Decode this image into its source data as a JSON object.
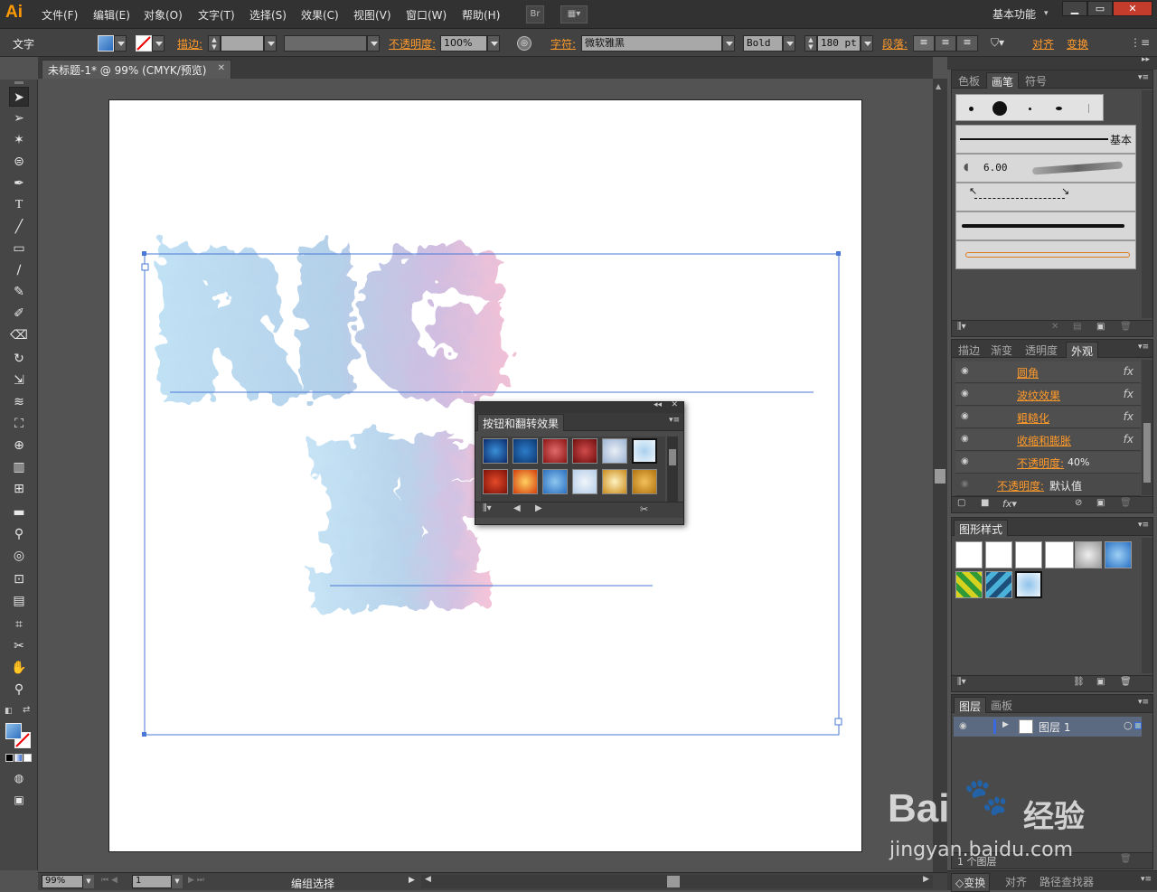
{
  "app": {
    "logo": "Ai",
    "workspace": "基本功能",
    "win_min": "▁",
    "win_max": "▭",
    "win_close": "✕"
  },
  "menus": [
    "文件(F)",
    "编辑(E)",
    "对象(O)",
    "文字(T)",
    "选择(S)",
    "效果(C)",
    "视图(V)",
    "窗口(W)",
    "帮助(H)"
  ],
  "menu_buttons": {
    "bridge": "Br"
  },
  "control": {
    "type_label": "文字",
    "stroke_label": "描边:",
    "opacity_label": "不透明度:",
    "opacity_value": "100%",
    "char_label": "字符:",
    "font": "微软雅黑",
    "weight": "Bold",
    "size": "180 pt",
    "para_label": "段落:",
    "align_label": "对齐",
    "transform_label": "变换"
  },
  "document": {
    "tab": "未标题-1* @ 99% (CMYK/预览)",
    "close": "✕",
    "artwork_text": "RIG",
    "artwork_text_2": "蓝"
  },
  "status": {
    "zoom": "99%",
    "page": "1",
    "mode": "编组选择"
  },
  "brushes_panel": {
    "tabs": [
      "色板",
      "画笔",
      "符号"
    ],
    "basic": "基本",
    "size": "6.00"
  },
  "appearance_panel": {
    "tabs": [
      "描边",
      "渐变",
      "透明度",
      "外观"
    ],
    "rows": [
      "圆角",
      "波纹效果",
      "粗糙化",
      "收缩和膨胀"
    ],
    "opacity_row": "不透明度:",
    "opacity_row_value": "40%",
    "opacity_default": "不透明度:",
    "opacity_default_value": "默认值",
    "fx": "fx"
  },
  "graphic_styles": {
    "title": "图形样式"
  },
  "layers_panel": {
    "tabs": [
      "图层",
      "画板"
    ],
    "layer_name": "图层 1",
    "count": "1 个图层"
  },
  "bottom_tabs": [
    "◇变换",
    "对齐",
    "路径查找器"
  ],
  "float_panel": {
    "title": "按钮和翻转效果"
  },
  "watermark": {
    "brand": "Bai",
    "brand2": "经验",
    "url": "jingyan.baidu.com"
  }
}
